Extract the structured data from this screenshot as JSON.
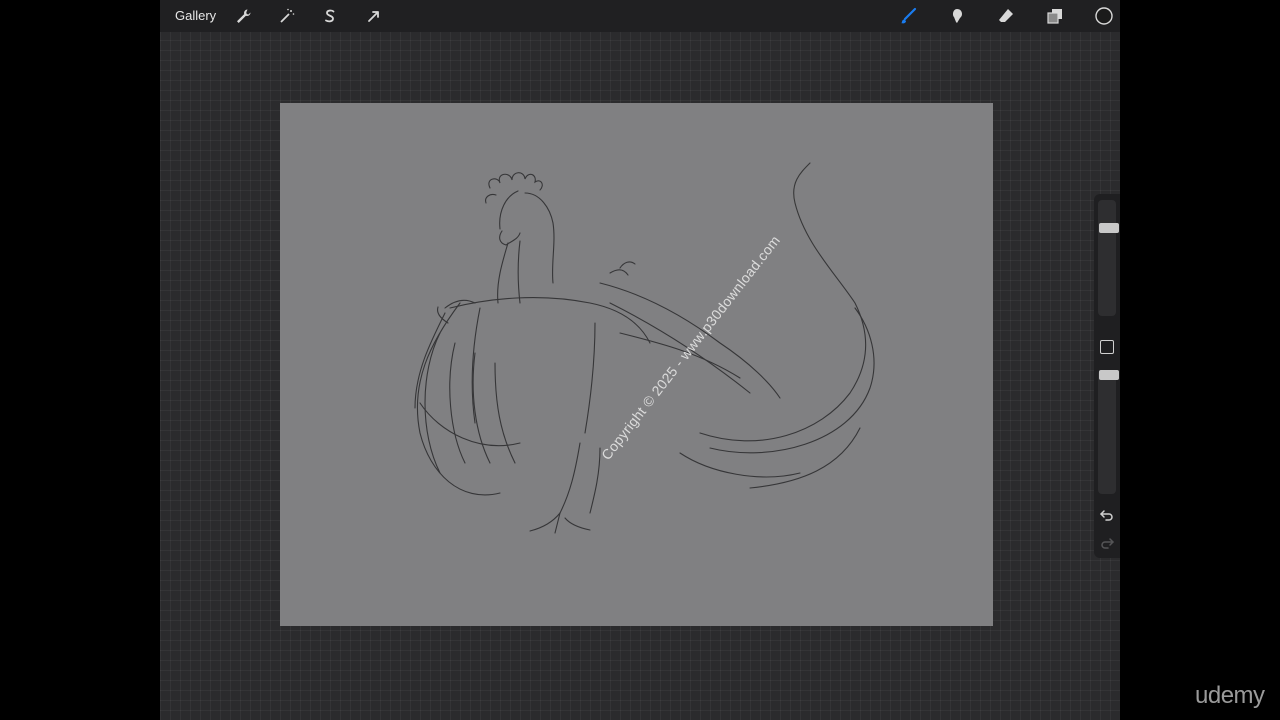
{
  "toolbar": {
    "gallery_label": "Gallery",
    "left_tools": [
      {
        "name": "actions",
        "icon": "wrench-icon"
      },
      {
        "name": "adjustments",
        "icon": "magic-wand-icon"
      },
      {
        "name": "selection",
        "icon": "selection-s-icon"
      },
      {
        "name": "transform",
        "icon": "arrow-cursor-icon"
      }
    ],
    "right_tools": [
      {
        "name": "brush",
        "icon": "brush-icon",
        "active": true
      },
      {
        "name": "smudge",
        "icon": "smudge-icon"
      },
      {
        "name": "eraser",
        "icon": "eraser-icon"
      },
      {
        "name": "layers",
        "icon": "layers-icon"
      },
      {
        "name": "color",
        "icon": "color-circle-icon"
      }
    ]
  },
  "colors": {
    "accent": "#1a7cf0",
    "canvas_bg": "#808082",
    "workspace_bg": "#2b2b2d",
    "toolbar_bg": "#202022"
  },
  "canvas": {
    "watermark": "Copyright © 2025 - www.p30download.com"
  },
  "sidebar": {
    "brush_size_level": 0.78,
    "opacity_level": 1.0,
    "icons": [
      "modify-square-icon",
      "undo-icon",
      "redo-icon"
    ]
  },
  "brand": "udemy"
}
